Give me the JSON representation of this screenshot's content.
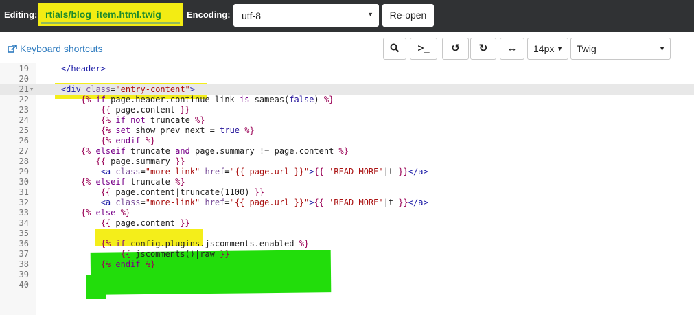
{
  "header": {
    "editing_label": "Editing:",
    "filename": "rtials/blog_item.html.twig",
    "encoding_label": "Encoding:",
    "encoding_value": "utf-8",
    "reopen_label": "Re-open"
  },
  "toolbar": {
    "keyboard_shortcuts": "Keyboard shortcuts",
    "search_icon": "search-icon",
    "goto_icon": "terminal-icon",
    "undo_icon": "undo-icon",
    "redo_icon": "redo-icon",
    "wrap_icon": "wrap-icon",
    "font_size": "14px",
    "mode": "Twig"
  },
  "editor": {
    "active_line": 21,
    "lines": [
      {
        "n": "19",
        "text": "    </header>"
      },
      {
        "n": "20",
        "text": ""
      },
      {
        "n": "21",
        "text": "    <div class=\"entry-content\">"
      },
      {
        "n": "22",
        "text": "        {% if page.header.continue_link is sameas(false) %}"
      },
      {
        "n": "23",
        "text": "            {{ page.content }}"
      },
      {
        "n": "24",
        "text": "            {% if not truncate %}"
      },
      {
        "n": "25",
        "text": "            {% set show_prev_next = true %}"
      },
      {
        "n": "26",
        "text": "            {% endif %}"
      },
      {
        "n": "27",
        "text": "        {% elseif truncate and page.summary != page.content %}"
      },
      {
        "n": "28",
        "text": "           {{ page.summary }}"
      },
      {
        "n": "29",
        "text": "            <a class=\"more-link\" href=\"{{ page.url }}\">{{ 'READ_MORE'|t }}</a>"
      },
      {
        "n": "30",
        "text": "        {% elseif truncate %}"
      },
      {
        "n": "31",
        "text": "            {{ page.content|truncate(1100) }}"
      },
      {
        "n": "32",
        "text": "            <a class=\"more-link\" href=\"{{ page.url }}\">{{ 'READ_MORE'|t }}</a>"
      },
      {
        "n": "33",
        "text": "        {% else %}"
      },
      {
        "n": "34",
        "text": "            {{ page.content }}"
      },
      {
        "n": "35",
        "text": ""
      },
      {
        "n": "36",
        "text": "            {% if config.plugins.jscomments.enabled %}"
      },
      {
        "n": "37",
        "text": "                {{ jscomments()|raw }}"
      },
      {
        "n": "38",
        "text": "            {% endif %}"
      },
      {
        "n": "39",
        "text": ""
      },
      {
        "n": "40",
        "text": ""
      }
    ]
  },
  "highlight_colors": {
    "yellow": "#f4ee1a",
    "green": "#22dd0b"
  }
}
